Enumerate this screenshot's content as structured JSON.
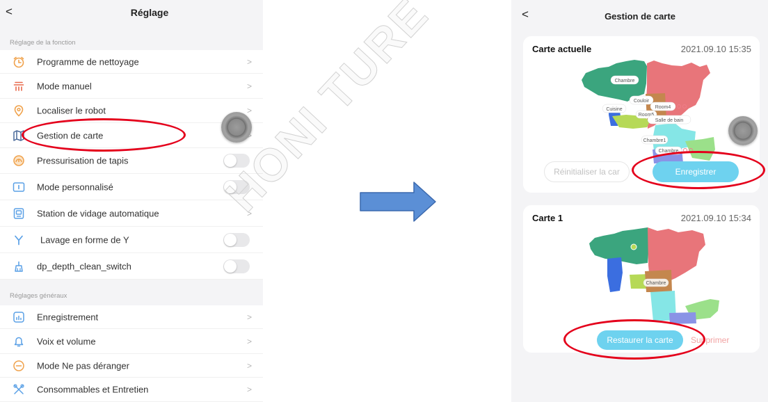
{
  "left_screen": {
    "header": {
      "back_label": "<",
      "title": "Réglage"
    },
    "chevron": ">",
    "sections": [
      {
        "title": "Réglage de la fonction",
        "items": [
          {
            "label": "Programme de nettoyage",
            "icon": "clock-icon",
            "control": "chevron"
          },
          {
            "label": "Mode manuel",
            "icon": "manual-mode-icon",
            "control": "chevron"
          },
          {
            "label": "Localiser le robot",
            "icon": "location-pin-icon",
            "control": "chevron"
          },
          {
            "label": "Gestion de carte",
            "icon": "map-icon",
            "control": "chevron",
            "highlighted": true
          },
          {
            "label": "Pressurisation de tapis",
            "icon": "carpet-boost-icon",
            "control": "toggle",
            "on": false
          },
          {
            "label": "Mode personnalisé",
            "icon": "custom-mode-icon",
            "control": "toggle",
            "on": false
          },
          {
            "label": "Station de vidage automatique",
            "icon": "dock-station-icon",
            "control": "chevron"
          },
          {
            "label": "Lavage en forme de Y",
            "icon": "y-pattern-icon",
            "control": "toggle",
            "on": false
          },
          {
            "label": "dp_depth_clean_switch",
            "icon": "deep-clean-icon",
            "control": "toggle",
            "on": false
          }
        ]
      },
      {
        "title": "Réglages généraux",
        "items": [
          {
            "label": "Enregistrement",
            "icon": "history-record-icon",
            "control": "chevron"
          },
          {
            "label": "Voix et volume",
            "icon": "bell-icon",
            "control": "chevron"
          },
          {
            "label": "Mode Ne pas déranger",
            "icon": "do-not-disturb-icon",
            "control": "chevron"
          },
          {
            "label": "Consommables et Entretien",
            "icon": "consumables-icon",
            "control": "chevron"
          }
        ]
      }
    ]
  },
  "right_screen": {
    "header": {
      "back_label": "<",
      "title": "Gestion de carte"
    },
    "cards": [
      {
        "title": "Carte actuelle",
        "timestamp": "2021.09.10 15:35",
        "room_labels": [
          "Chambre",
          "Room4",
          "Couloir",
          "Cuisine",
          "Room5",
          "Salle de bain",
          "Chambre1",
          "Chambre"
        ],
        "secondary_button": "Réinitialiser la car",
        "primary_button": "Enregistrer",
        "highlighted": "primary_button"
      },
      {
        "title": "Carte 1",
        "timestamp": "2021.09.10 15:34",
        "room_labels": [
          "Chambre"
        ],
        "primary_button": "Restaurer la carte",
        "secondary_button": "Supprimer",
        "highlighted": "primary_button"
      }
    ]
  },
  "watermark": "HONI TURE",
  "colors": {
    "highlight_red": "#e4001b",
    "arrow_blue": "#5b8fd6",
    "button_blue": "#6ed2ef",
    "delete_pink": "#f2a3a3",
    "icon_orange": "#f0a24c",
    "icon_blue": "#5aa0e6"
  }
}
